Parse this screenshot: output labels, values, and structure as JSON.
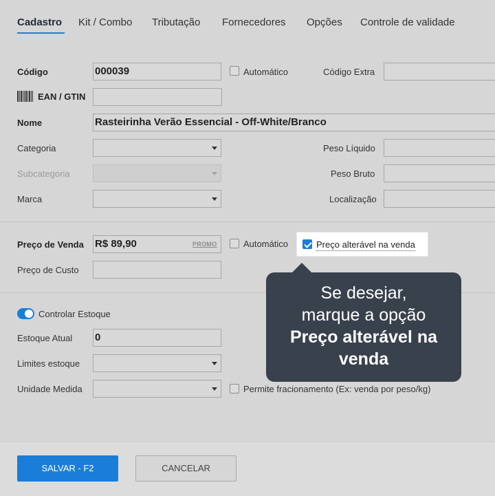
{
  "tabs": [
    {
      "label": "Cadastro"
    },
    {
      "label": "Kit / Combo"
    },
    {
      "label": "Tributação"
    },
    {
      "label": "Fornecedores"
    },
    {
      "label": "Opções"
    },
    {
      "label": "Controle de validade"
    }
  ],
  "form": {
    "codigo_label": "Código",
    "codigo_value": "000039",
    "automatico_label": "Automático",
    "codigo_extra_label": "Código Extra",
    "codigo_extra_value": "",
    "ean_label": "EAN / GTIN",
    "ean_value": "",
    "nome_label": "Nome",
    "nome_value": "Rasteirinha Verão Essencial - Off-White/Branco",
    "categoria_label": "Categoria",
    "subcategoria_label": "Subcategoria",
    "marca_label": "Marca",
    "peso_liquido_label": "Peso Líquido",
    "peso_bruto_label": "Peso Bruto",
    "localizacao_label": "Localização",
    "preco_venda_label": "Preço de Venda",
    "preco_venda_value": "R$ 89,90",
    "promo_label": "PROMO",
    "preco_automatico_label": "Automático",
    "preco_alteravel_label": "Preço alterável na venda",
    "preco_custo_label": "Preço de Custo",
    "controlar_estoque_label": "Controlar Estoque",
    "estoque_atual_label": "Estoque Atual",
    "estoque_atual_value": "0",
    "limites_estoque_label": "Limites estoque",
    "unidade_medida_label": "Unidade Medida",
    "permite_fracionamento_label": "Permite fracionamento (Ex: venda por peso/kg)"
  },
  "tooltip": {
    "line1": "Se desejar,",
    "line2": "marque a opção",
    "line3": "Preço alterável na",
    "line4": "venda"
  },
  "footer": {
    "save_label": "SALVAR - F2",
    "cancel_label": "CANCELAR"
  },
  "colors": {
    "accent": "#1a7ed8",
    "tooltip_bg": "#39414d"
  }
}
